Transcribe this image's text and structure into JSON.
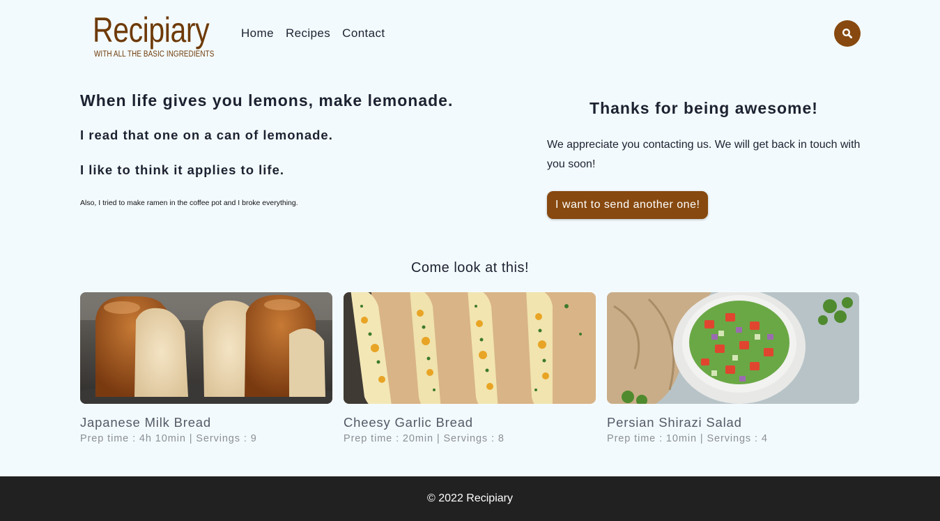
{
  "brand": {
    "name": "Recipiary",
    "tagline": "WITH ALL THE BASIC INGREDIENTS",
    "color": "#6e3a07"
  },
  "nav": {
    "items": [
      "Home",
      "Recipes",
      "Contact"
    ],
    "search_icon": "search-icon"
  },
  "quotes": {
    "line1": "When life gives you lemons, make lemonade.",
    "line2": "I read that one on a can of lemonade.",
    "line3": "I like to think it applies to life.",
    "line4": "Also, I tried to make ramen in the coffee pot and I broke everything."
  },
  "thanks": {
    "title": "Thanks for being awesome!",
    "message": "We appreciate you contacting us. We will get back in touch with you soon!",
    "button_label": "I want to send another one!"
  },
  "featured": {
    "title": "Come look at this!",
    "cards": [
      {
        "title": "Japanese Milk Bread",
        "meta": "Prep time : 4h 10min | Servings : 9",
        "image": "milk-bread-photo"
      },
      {
        "title": "Cheesy Garlic Bread",
        "meta": "Prep time : 20min | Servings : 8",
        "image": "garlic-bread-photo"
      },
      {
        "title": "Persian Shirazi Salad",
        "meta": "Prep time : 10min | Servings : 4",
        "image": "shirazi-salad-photo"
      }
    ]
  },
  "footer": {
    "text": "© 2022 Recipiary"
  },
  "colors": {
    "accent": "#87490f",
    "background": "#f3fafd",
    "footer_bg": "#212121"
  }
}
